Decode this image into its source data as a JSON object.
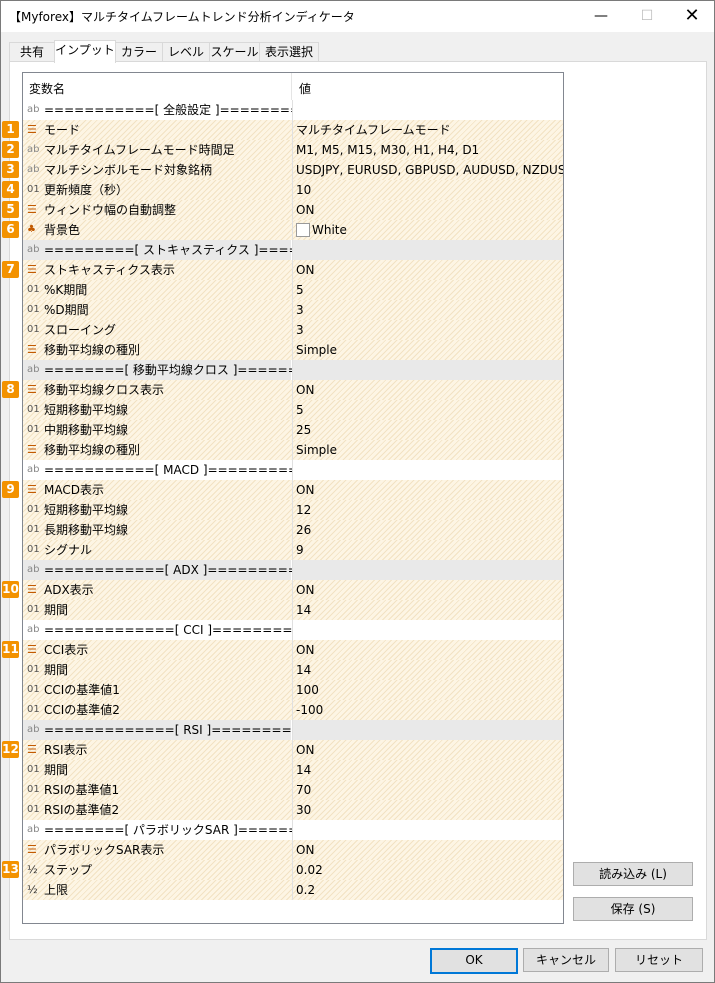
{
  "window": {
    "title": "【Myforex】マルチタイムフレームトレンド分析インディケータ"
  },
  "titlebar": {
    "minimize": "—",
    "maximize": "☐",
    "close": "✕"
  },
  "tabs": [
    "共有",
    "インプット",
    "カラー",
    "レベル",
    "スケール",
    "表示選択"
  ],
  "grid": {
    "header": {
      "name": "変数名",
      "value": "値"
    },
    "rows": [
      {
        "icon": "ab",
        "name": "===========[ 全般設定 ]==========",
        "value": "",
        "kind": "sep"
      },
      {
        "icon": "list",
        "name": "モード",
        "value": "マルチタイムフレームモード",
        "kind": "hatch"
      },
      {
        "icon": "ab",
        "name": "マルチタイムフレームモード時間足",
        "value": "M1, M5, M15, M30, H1, H4, D1",
        "kind": "hatch"
      },
      {
        "icon": "ab",
        "name": "マルチシンボルモード対象銘柄",
        "value": "USDJPY, EURUSD, GBPUSD, AUDUSD, NZDUSD, ...",
        "kind": "hatch"
      },
      {
        "icon": "01",
        "name": "更新頻度（秒）",
        "value": "10",
        "kind": "hatch"
      },
      {
        "icon": "list",
        "name": "ウィンドウ幅の自動調整",
        "value": "ON",
        "kind": "hatch"
      },
      {
        "icon": "color",
        "name": "背景色",
        "value": "White",
        "kind": "color"
      },
      {
        "icon": "ab",
        "name": "=========[ ストキャスティクス ]========",
        "value": "",
        "kind": "sep-grey"
      },
      {
        "icon": "list",
        "name": "ストキャスティクス表示",
        "value": "ON",
        "kind": "hatch"
      },
      {
        "icon": "01",
        "name": "%K期間",
        "value": "5",
        "kind": "hatch"
      },
      {
        "icon": "01",
        "name": "%D期間",
        "value": "3",
        "kind": "hatch"
      },
      {
        "icon": "01",
        "name": "スローイング",
        "value": "3",
        "kind": "hatch"
      },
      {
        "icon": "list",
        "name": "移動平均線の種別",
        "value": "Simple",
        "kind": "hatch"
      },
      {
        "icon": "ab",
        "name": "========[ 移動平均線クロス ]========",
        "value": "",
        "kind": "sep-grey"
      },
      {
        "icon": "list",
        "name": "移動平均線クロス表示",
        "value": "ON",
        "kind": "hatch"
      },
      {
        "icon": "01",
        "name": "短期移動平均線",
        "value": "5",
        "kind": "hatch"
      },
      {
        "icon": "01",
        "name": "中期移動平均線",
        "value": "25",
        "kind": "hatch"
      },
      {
        "icon": "list",
        "name": "移動平均線の種別",
        "value": "Simple",
        "kind": "hatch"
      },
      {
        "icon": "ab",
        "name": "===========[ MACD ]============",
        "value": "",
        "kind": "sep"
      },
      {
        "icon": "list",
        "name": "MACD表示",
        "value": "ON",
        "kind": "hatch"
      },
      {
        "icon": "01",
        "name": "短期移動平均線",
        "value": "12",
        "kind": "hatch"
      },
      {
        "icon": "01",
        "name": "長期移動平均線",
        "value": "26",
        "kind": "hatch"
      },
      {
        "icon": "01",
        "name": "シグナル",
        "value": "9",
        "kind": "hatch"
      },
      {
        "icon": "ab",
        "name": "============[ ADX ]============",
        "value": "",
        "kind": "sep-grey"
      },
      {
        "icon": "list",
        "name": "ADX表示",
        "value": "ON",
        "kind": "hatch"
      },
      {
        "icon": "01",
        "name": "期間",
        "value": "14",
        "kind": "hatch"
      },
      {
        "icon": "ab",
        "name": "=============[ CCI ]============",
        "value": "",
        "kind": "sep"
      },
      {
        "icon": "list",
        "name": "CCI表示",
        "value": "ON",
        "kind": "hatch"
      },
      {
        "icon": "01",
        "name": "期間",
        "value": "14",
        "kind": "hatch"
      },
      {
        "icon": "01",
        "name": "CCIの基準値1",
        "value": "100",
        "kind": "hatch"
      },
      {
        "icon": "01",
        "name": "CCIの基準値2",
        "value": "-100",
        "kind": "hatch"
      },
      {
        "icon": "ab",
        "name": "=============[ RSI ]============",
        "value": "",
        "kind": "sep-grey"
      },
      {
        "icon": "list",
        "name": "RSI表示",
        "value": "ON",
        "kind": "hatch"
      },
      {
        "icon": "01",
        "name": "期間",
        "value": "14",
        "kind": "hatch"
      },
      {
        "icon": "01",
        "name": "RSIの基準値1",
        "value": "70",
        "kind": "hatch"
      },
      {
        "icon": "01",
        "name": "RSIの基準値2",
        "value": "30",
        "kind": "hatch"
      },
      {
        "icon": "ab",
        "name": "========[ パラボリックSAR ]=========",
        "value": "",
        "kind": "sep"
      },
      {
        "icon": "list",
        "name": "パラボリックSAR表示",
        "value": "ON",
        "kind": "hatch"
      },
      {
        "icon": "half",
        "name": "ステップ",
        "value": "0.02",
        "kind": "hatch"
      },
      {
        "icon": "half",
        "name": "上限",
        "value": "0.2",
        "kind": "hatch"
      }
    ]
  },
  "badges": [
    {
      "label": "1",
      "row": 1
    },
    {
      "label": "2",
      "row": 2
    },
    {
      "label": "3",
      "row": 3
    },
    {
      "label": "4",
      "row": 4
    },
    {
      "label": "5",
      "row": 5
    },
    {
      "label": "6",
      "row": 6
    },
    {
      "label": "7",
      "row": 8
    },
    {
      "label": "8",
      "row": 14
    },
    {
      "label": "9",
      "row": 19
    },
    {
      "label": "10",
      "row": 24
    },
    {
      "label": "11",
      "row": 27
    },
    {
      "label": "12",
      "row": 32
    },
    {
      "label": "13",
      "row": 38
    }
  ],
  "side_buttons": {
    "load": "読み込み (L)",
    "save": "保存 (S)"
  },
  "bottom_buttons": {
    "ok": "OK",
    "cancel": "キャンセル",
    "reset": "リセット"
  },
  "colors": {
    "badge": "#f39200",
    "hatch_light": "#fdf5e4",
    "hatch_dark": "#f2e2c3",
    "primary_border": "#0078d7"
  },
  "icon_glyphs": {
    "list": "☰",
    "ab": "ab",
    "01": "01",
    "half": "½",
    "color": "♣"
  }
}
